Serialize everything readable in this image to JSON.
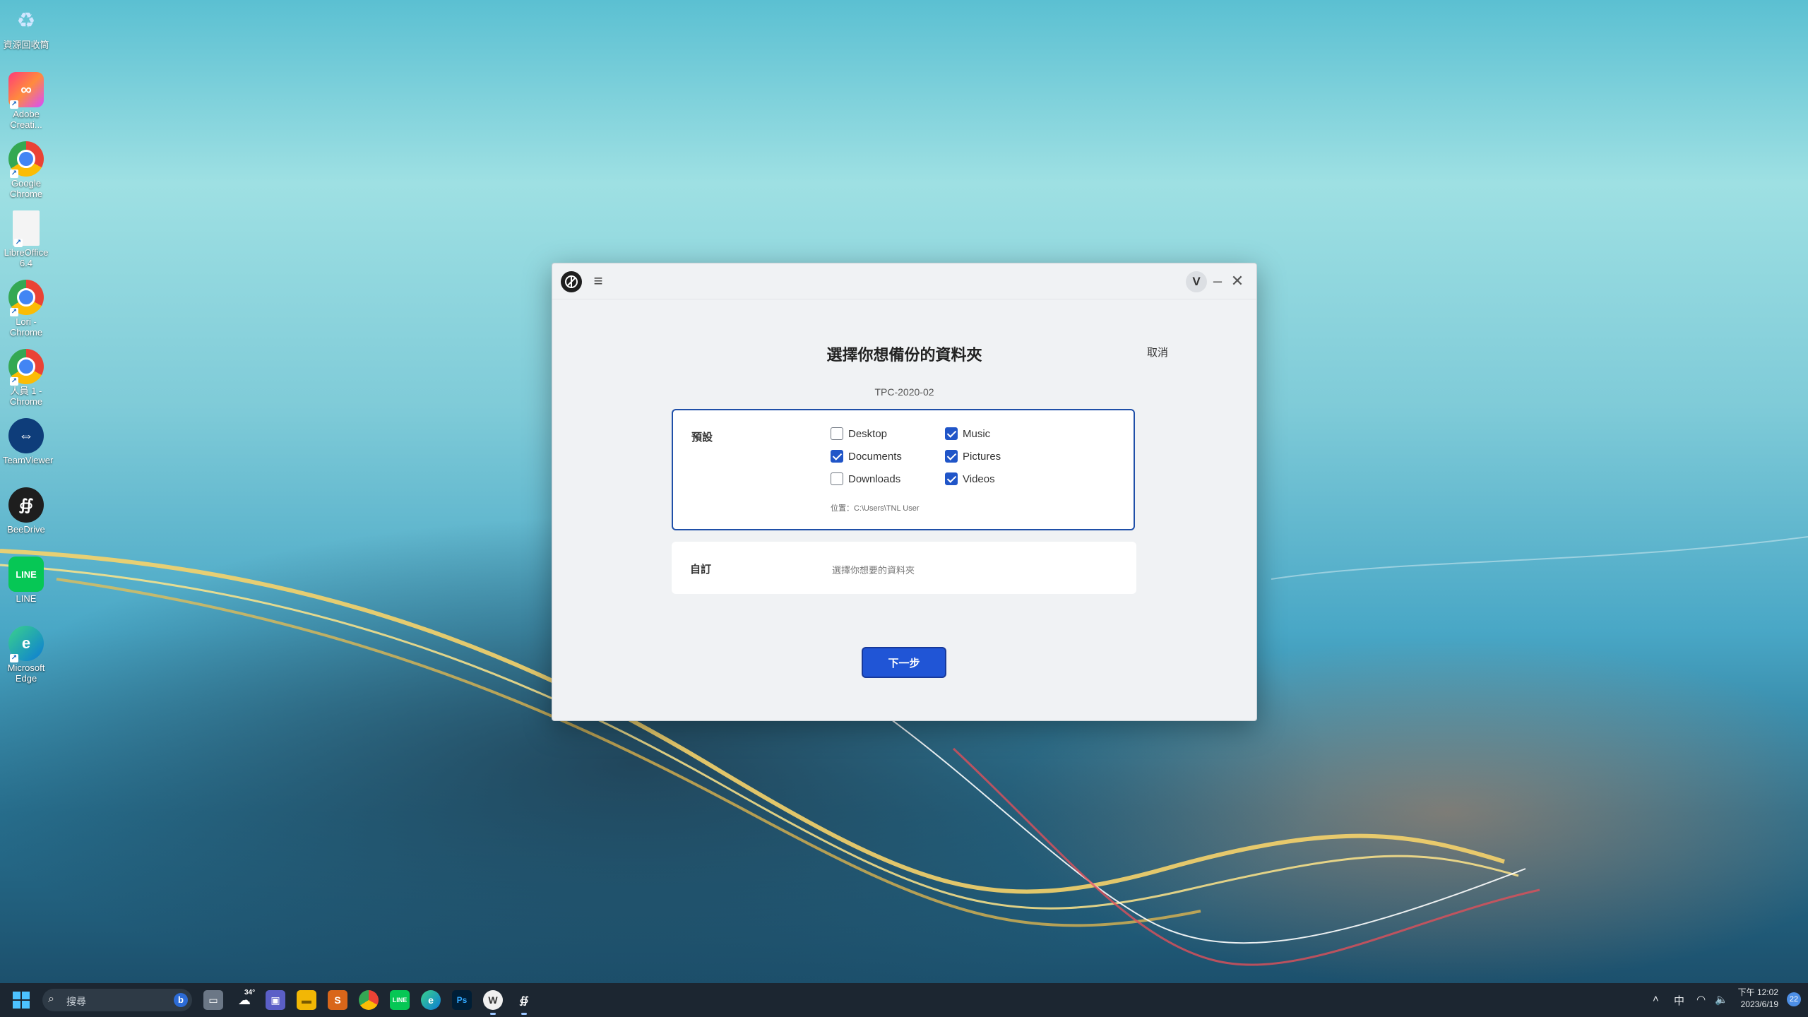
{
  "desktop": {
    "icons": [
      {
        "label": "資源回收筒",
        "icon": "recycle-bin-icon"
      },
      {
        "label": "Adobe Creati...",
        "icon": "adobe-creative-cloud-icon"
      },
      {
        "label": "Google Chrome",
        "icon": "chrome-icon"
      },
      {
        "label": "LibreOffice 6.4",
        "icon": "libreoffice-icon"
      },
      {
        "label": "Lori - Chrome",
        "icon": "chrome-profile-icon"
      },
      {
        "label": "人員 1 - Chrome",
        "icon": "chrome-profile-icon"
      },
      {
        "label": "TeamViewer",
        "icon": "teamviewer-icon"
      },
      {
        "label": "BeeDrive",
        "icon": "beedrive-icon"
      },
      {
        "label": "LINE",
        "icon": "line-icon"
      },
      {
        "label": "Microsoft Edge",
        "icon": "edge-icon"
      }
    ]
  },
  "window": {
    "avatar_letter": "V",
    "menu_icon": "hamburger-icon",
    "minimize_glyph": "–",
    "close_glyph": "✕",
    "dialog_title": "選擇你想備份的資料夾",
    "cancel_label": "取消",
    "device_name": "TPC-2020-02",
    "default_section": {
      "label": "預設",
      "folders": [
        {
          "name": "Desktop",
          "checked": false
        },
        {
          "name": "Documents",
          "checked": true
        },
        {
          "name": "Downloads",
          "checked": false
        },
        {
          "name": "Music",
          "checked": true
        },
        {
          "name": "Pictures",
          "checked": true
        },
        {
          "name": "Videos",
          "checked": true
        }
      ],
      "location": "位置：C:\\Users\\TNL User"
    },
    "custom_section": {
      "label": "自訂",
      "prompt": "選擇你想要的資料夾"
    },
    "next_label": "下一步"
  },
  "taskbar": {
    "search_placeholder": "搜尋",
    "weather_temp": "34°",
    "ime": "中",
    "time": "下午 12:02",
    "date": "2023/6/19",
    "notification_count": "22",
    "colors": {
      "accent": "#2055d6",
      "taskbar": "#1c2631"
    }
  }
}
